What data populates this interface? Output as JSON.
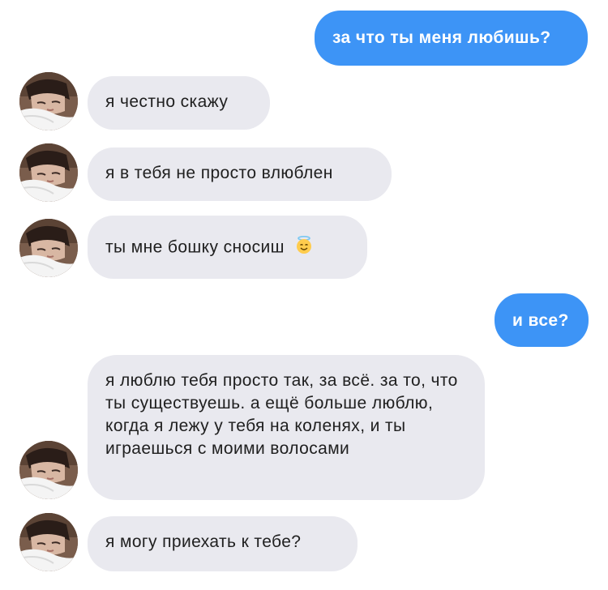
{
  "chat": {
    "messages": [
      {
        "id": "m1",
        "sender": "me",
        "text": "за что ты меня любишь?"
      },
      {
        "id": "m2",
        "sender": "them",
        "text": "я честно скажу"
      },
      {
        "id": "m3",
        "sender": "them",
        "text": "я в тебя не просто влюблен"
      },
      {
        "id": "m4",
        "sender": "them",
        "text": "ты мне бошку сносиш",
        "emoji": "smiling-face-with-halo"
      },
      {
        "id": "m5",
        "sender": "me",
        "text": "и все?"
      },
      {
        "id": "m6",
        "sender": "them",
        "text": "я люблю тебя просто так, за всё. за то, что ты существуешь. а ещё больше люблю, когда я лежу у тебя на коленях, и ты играешься с моими волосами"
      },
      {
        "id": "m7",
        "sender": "them",
        "text": "я могу приехать к тебе?"
      }
    ]
  },
  "colors": {
    "outgoing_bubble": "#3d94f6",
    "incoming_bubble": "#e9e9ef",
    "outgoing_text": "#ffffff",
    "incoming_text": "#202020"
  }
}
